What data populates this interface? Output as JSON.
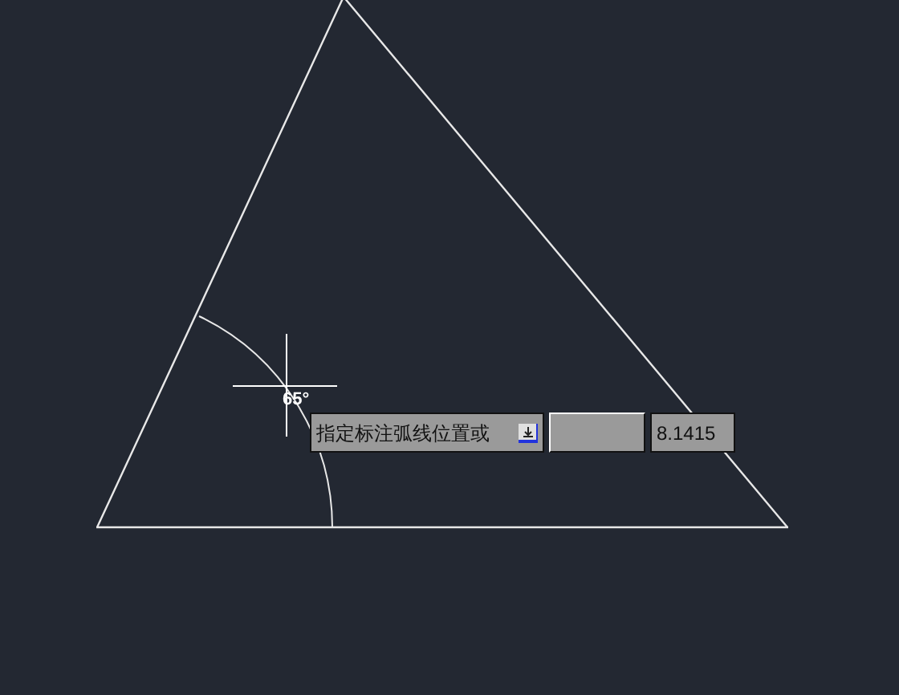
{
  "canvas": {
    "angle_label": "65°"
  },
  "dynamic_input": {
    "prompt": "指定标注弧线位置或",
    "value": "8.1415"
  }
}
